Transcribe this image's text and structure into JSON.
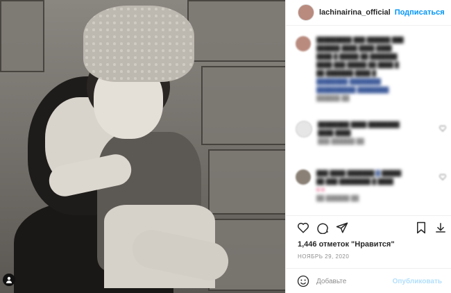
{
  "header": {
    "username": "lachinairina_official",
    "follow_label": "Подписаться"
  },
  "post": {
    "likes_text": "1,446 отметок \"Нравится\"",
    "date_text": "НОЯБРЬ 29, 2020"
  },
  "comment_input": {
    "placeholder": "Добавьте",
    "publish_label": "Опубликовать"
  },
  "icons": {
    "like": "heart-icon",
    "comment": "comment-icon",
    "share": "paper-plane-icon",
    "save": "bookmark-icon",
    "download": "download-icon",
    "emoji": "smile-icon",
    "tagged": "person-tag-icon"
  },
  "colors": {
    "accent": "#0095f6",
    "text": "#262626",
    "muted": "#8e8e8e"
  }
}
